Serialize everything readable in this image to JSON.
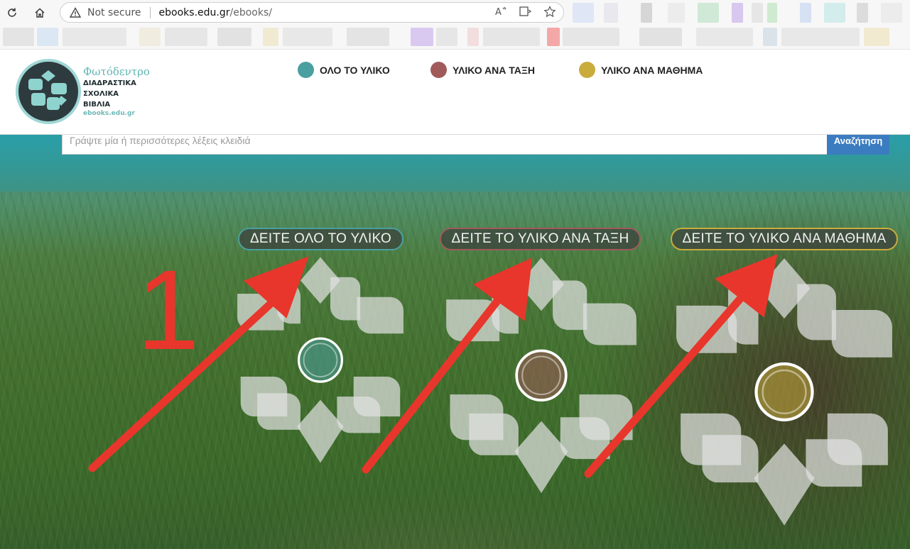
{
  "browser": {
    "security_label": "Not secure",
    "url_host": "ebooks.edu.gr",
    "url_path": "/ebooks/",
    "icons": [
      "refresh-icon",
      "home-icon",
      "warning-icon",
      "read-aloud-icon",
      "immersive-reader-icon",
      "favorite-star-icon"
    ]
  },
  "site": {
    "logo": {
      "title": "Φωτόδεντρο",
      "line1": "ΔΙΑΔΡΑΣΤΙΚΑ",
      "line2": "ΣΧΟΛΙΚΑ",
      "line3": "ΒΙΒΛΙΑ",
      "url": "ebooks.edu.gr"
    },
    "nav": [
      {
        "label": "ΟΛΟ ΤΟ ΥΛΙΚΟ",
        "color": "#4a9fa0"
      },
      {
        "label": "ΥΛΙΚΟ ΑΝΑ ΤΑΞΗ",
        "color": "#a05a5a"
      },
      {
        "label": "ΥΛΙΚΟ ΑΝΑ ΜΑΘΗΜΑ",
        "color": "#c9ac3c"
      }
    ]
  },
  "search": {
    "placeholder": "Γράψτε μία ή περισσότερες λέξεις κλειδιά",
    "button_label": "Αναζήτηση"
  },
  "sections": [
    {
      "label": "ΔΕΙΤΕ ΟΛΟ ΤΟ ΥΛΙΚΟ",
      "color": "#4a9fa0"
    },
    {
      "label": "ΔΕΙΤΕ ΤΟ ΥΛΙΚΟ ΑΝΑ ΤΑΞΗ",
      "color": "#a05a5a"
    },
    {
      "label": "ΔΕΙΤΕ ΤΟ ΥΛΙΚΟ ΑΝΑ ΜΑΘΗΜΑ",
      "color": "#c9ac3c"
    }
  ],
  "annotation": {
    "step_number": "1",
    "color": "#e8362c"
  }
}
